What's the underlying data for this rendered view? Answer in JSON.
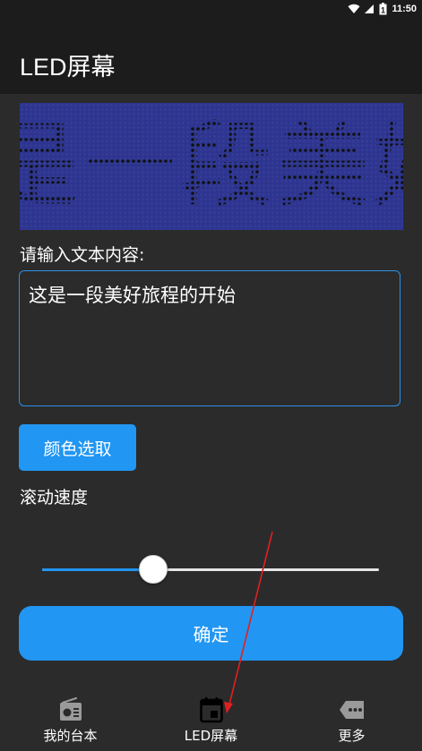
{
  "status_bar": {
    "time": "11:50",
    "battery_level": "1",
    "icons": [
      "wifi-icon",
      "signal-icon",
      "battery-icon"
    ]
  },
  "app_bar": {
    "title": "LED屏幕"
  },
  "led_display": {
    "text": "是一段美好",
    "background_color": "#2d3591"
  },
  "form": {
    "prompt_label": "请输入文本内容:",
    "text_value": "这是一段美好旅程的开始",
    "color_button_label": "颜色选取",
    "speed_label": "滚动速度",
    "speed_value": 0.33,
    "confirm_label": "确定"
  },
  "bottom_nav": {
    "items": [
      {
        "label": "我的台本",
        "icon": "radio-icon"
      },
      {
        "label": "LED屏幕",
        "icon": "calendar-icon"
      },
      {
        "label": "更多",
        "icon": "more-tag-icon"
      }
    ]
  },
  "colors": {
    "accent": "#2196f3",
    "background": "#2b2b2b",
    "bar": "#1c1c1c",
    "annotation_arrow": "#e02020"
  }
}
